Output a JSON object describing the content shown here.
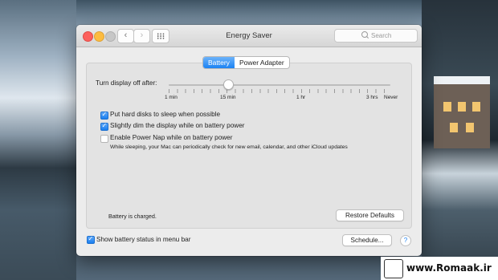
{
  "window": {
    "title": "Energy Saver",
    "search_placeholder": "Search"
  },
  "tabs": [
    {
      "label": "Battery",
      "active": true
    },
    {
      "label": "Power Adapter",
      "active": false
    }
  ],
  "slider": {
    "label": "Turn display off after:",
    "value": "15 min",
    "tick_labels": [
      "1 min",
      "15 min",
      "1 hr",
      "3 hrs",
      "Never"
    ]
  },
  "options": [
    {
      "label": "Put hard disks to sleep when possible",
      "checked": true
    },
    {
      "label": "Slightly dim the display while on battery power",
      "checked": true
    },
    {
      "label": "Enable Power Nap while on battery power",
      "checked": false,
      "description": "While sleeping, your Mac can periodically check for new email, calendar, and other iCloud updates"
    }
  ],
  "status": "Battery is charged.",
  "buttons": {
    "restore": "Restore Defaults",
    "schedule": "Schedule...",
    "help": "?"
  },
  "footer": {
    "show_status_label": "Show battery status in menu bar",
    "show_status_checked": true
  },
  "watermark": "www.Romaak.ir",
  "colors": {
    "accent": "#1b82f3",
    "close": "#fc605c",
    "minimize": "#fdbc40"
  }
}
